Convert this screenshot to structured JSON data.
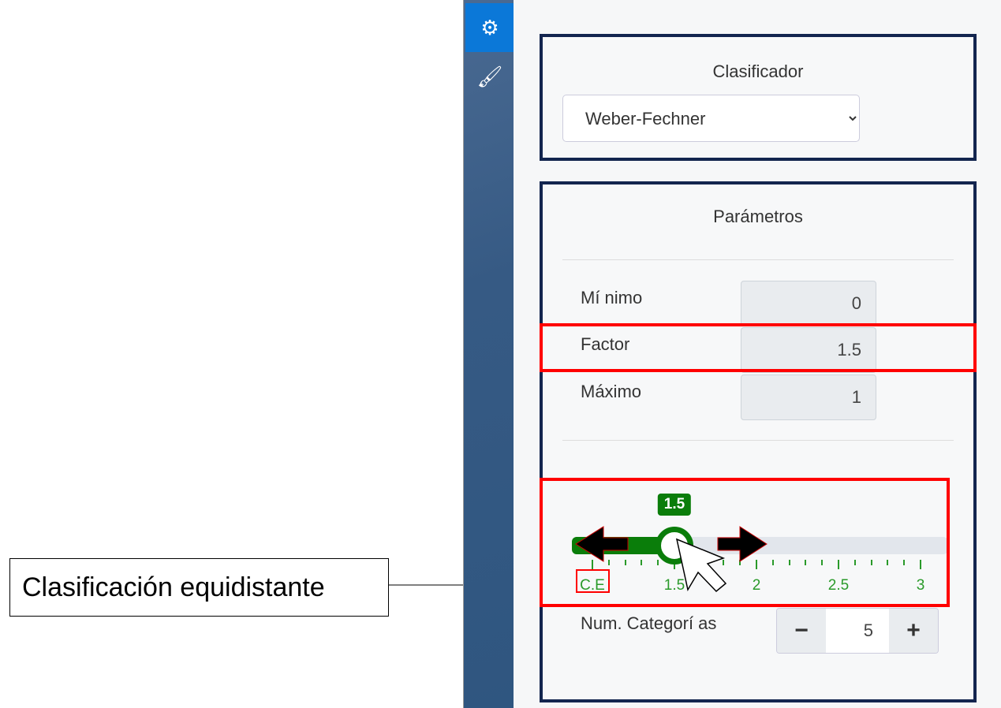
{
  "sidebar": {
    "items": [
      {
        "icon": "gears-icon",
        "active": true
      },
      {
        "icon": "brush-icon",
        "active": false
      }
    ],
    "active_color": "#0b78d8"
  },
  "classifier": {
    "title": "Clasificador",
    "selected": "Weber-Fechner"
  },
  "params": {
    "title": "Parámetros",
    "fields": [
      {
        "label": "Mí nimo",
        "value": "0"
      },
      {
        "label": "Factor",
        "value": "1.5"
      },
      {
        "label": "Máximo",
        "value": "1"
      }
    ],
    "slider": {
      "value": 1.5,
      "min": 1,
      "max": 3,
      "bubble": "1.5",
      "labels": [
        "C.E",
        "1.5",
        "2",
        "2.5",
        "3"
      ],
      "color": "#0a7d0a"
    },
    "categories": {
      "label": "Num. Categorí as",
      "value": "5",
      "minus": "−",
      "plus": "+"
    }
  },
  "annotation": {
    "text": "Clasificación equidistante"
  }
}
